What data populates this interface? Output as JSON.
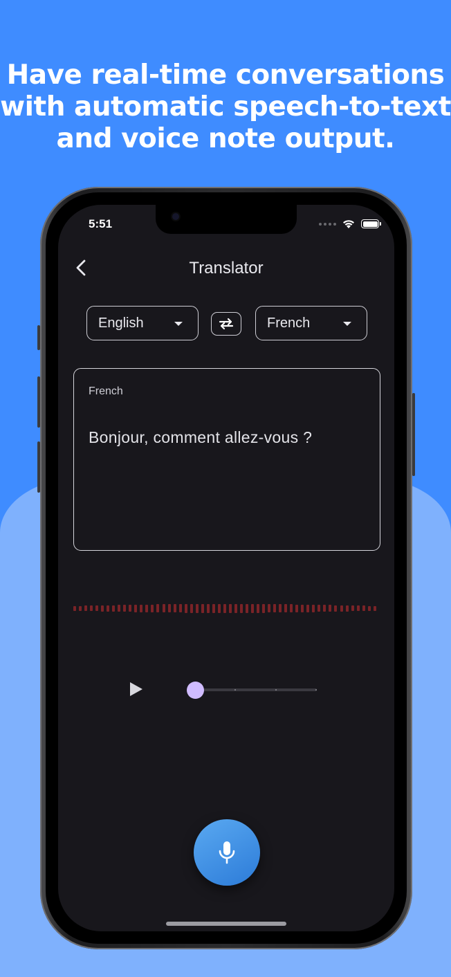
{
  "headline": {
    "line1": "Have real-time conversations",
    "line2": "with automatic speech-to-text",
    "line3": "and voice note output."
  },
  "status_bar": {
    "time": "5:51"
  },
  "app_bar": {
    "title": "Translator"
  },
  "language_bar": {
    "source_language": "English",
    "target_language": "French"
  },
  "translation_box": {
    "label": "French",
    "text": "Bonjour, comment allez-vous ?"
  },
  "audio_player": {
    "progress": 0
  },
  "colors": {
    "background_top": "#3f8cff",
    "background_bottom": "#7fb1fd",
    "screen_background": "#18171c",
    "waveform": "#7a2327",
    "slider_thumb": "#d0bcff",
    "mic_button": "#3a8ee6"
  },
  "icons": {
    "back": "chevron-left-icon",
    "swap": "swap-arrows-icon",
    "play": "play-icon",
    "mic": "microphone-icon"
  }
}
